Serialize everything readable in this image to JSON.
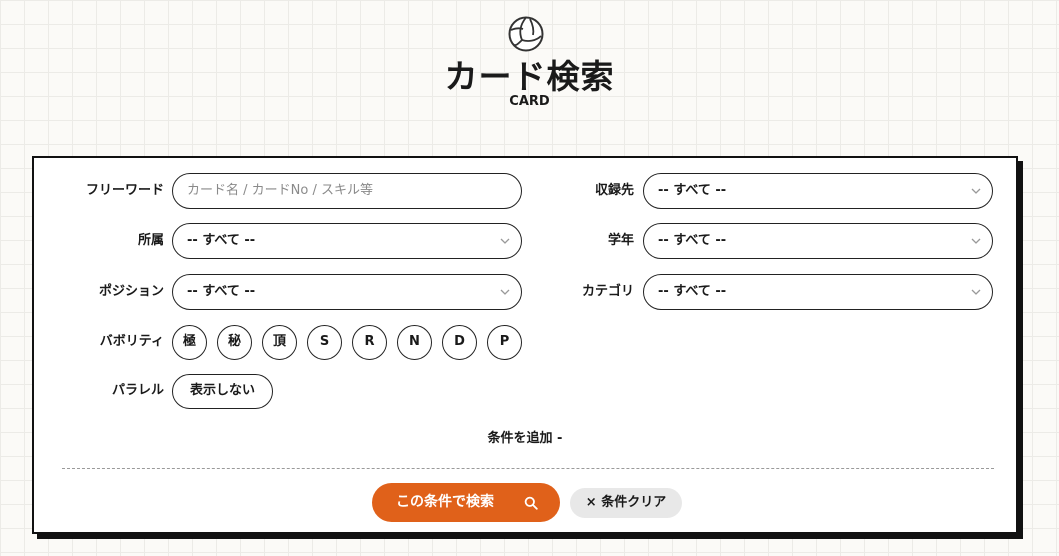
{
  "header": {
    "title": "カード検索",
    "subtitle": "CARD",
    "logo_icon": "volleyball-icon"
  },
  "form": {
    "free_word": {
      "label": "フリーワード",
      "placeholder": "カード名 / カードNo / スキル等"
    },
    "recorded_in": {
      "label": "収録先",
      "value": "-- すべて --"
    },
    "affiliation": {
      "label": "所属",
      "value": "-- すべて --"
    },
    "grade": {
      "label": "学年",
      "value": "-- すべて --"
    },
    "position": {
      "label": "ポジション",
      "value": "-- すべて --"
    },
    "category": {
      "label": "カテゴリ",
      "value": "-- すべて --"
    },
    "rarity": {
      "label": "バボリティ",
      "options": [
        "極",
        "秘",
        "頂",
        "S",
        "R",
        "N",
        "D",
        "P"
      ]
    },
    "parallel": {
      "label": "パラレル",
      "option": "表示しない"
    },
    "add_condition": "条件を追加 -",
    "search_button": "この条件で検索",
    "clear_button": "× 条件クリア"
  },
  "colors": {
    "accent": "#e0611a",
    "border": "#111111",
    "clear_bg": "#e8e8e8"
  }
}
